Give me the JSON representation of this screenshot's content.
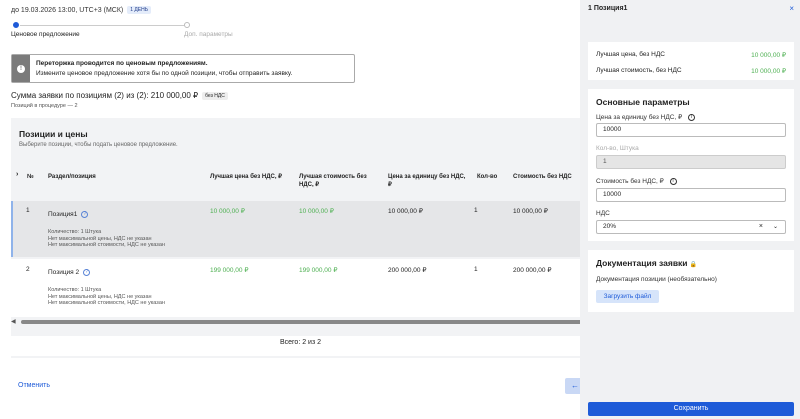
{
  "header": {
    "deadline": "до 19.03.2026 13:00, UTC+3 (МСК)",
    "day_badge": "1 ДЕНЬ"
  },
  "steps": [
    {
      "label": "Ценовое предложение",
      "active": true
    },
    {
      "label": "Доп. параметры",
      "active": false
    }
  ],
  "alert": {
    "title": "Переторжка проводится по ценовым предложениям.",
    "text": "Измените ценовое предложение хотя бы по одной позиции, чтобы отправить заявку."
  },
  "summary": {
    "text": "Сумма заявки по позициям (2) из (2): 210 000,00 ₽",
    "nds_badge": "без НДС",
    "note": "Позиций в процедуре — 2"
  },
  "table": {
    "title": "Позиции и цены",
    "subtitle": "Выберите позиции, чтобы подать ценовое предложение.",
    "headers": [
      "№",
      "Раздел/позиция",
      "Лучшая цена без НДС, ₽",
      "Лучшая стоимость без НДС, ₽",
      "Цена за единицу без НДС, ₽",
      "Кол-во",
      "Стоимость без НДС"
    ],
    "rows": [
      {
        "num": "1",
        "name": "Позиция1",
        "best_price": "10 000,00 ₽",
        "best_cost": "10 000,00 ₽",
        "unit_price": "10 000,00 ₽",
        "qty": "1",
        "cost": "10 000,00 ₽",
        "details": [
          "Количество: 1 Штука",
          "Нет максимальной цены, НДС не указан",
          "Нет максимальной стоимости, НДС не указан"
        ]
      },
      {
        "num": "2",
        "name": "Позиция 2",
        "best_price": "199 000,00 ₽",
        "best_cost": "199 000,00 ₽",
        "unit_price": "200 000,00 ₽",
        "qty": "1",
        "cost": "200 000,00 ₽",
        "details": [
          "Количество: 1 Штука",
          "Нет максимальной цены, НДС не указан",
          "Нет максимальной стоимости, НДС не указан"
        ]
      }
    ],
    "total": "Всего: 2 из 2"
  },
  "footer": {
    "cancel": "Отменить",
    "back_arrow": "←"
  },
  "panel": {
    "title": "1 Позиция1",
    "close": "×",
    "best_price_label": "Лучшая цена, без НДС",
    "best_price_value": "10 000,00 ₽",
    "best_cost_label": "Лучшая стоимость, без НДС",
    "best_cost_value": "10 000,00 ₽",
    "params_title": "Основные параметры",
    "unit_price_label": "Цена за единицу без НДС, ₽",
    "unit_price_value": "10000",
    "qty_label": "Кол-во, Штука",
    "qty_value": "1",
    "cost_label": "Стоимость без НДС, ₽",
    "cost_value": "10000",
    "nds_label": "НДС",
    "nds_value": "20%",
    "docs_title": "Документация заявки",
    "docs_label": "Документация позиции (необязательно)",
    "upload_label": "Загрузить файл",
    "save_label": "Сохранить"
  },
  "colors": {
    "accent": "#1e5bd8",
    "green": "#4caf50"
  }
}
